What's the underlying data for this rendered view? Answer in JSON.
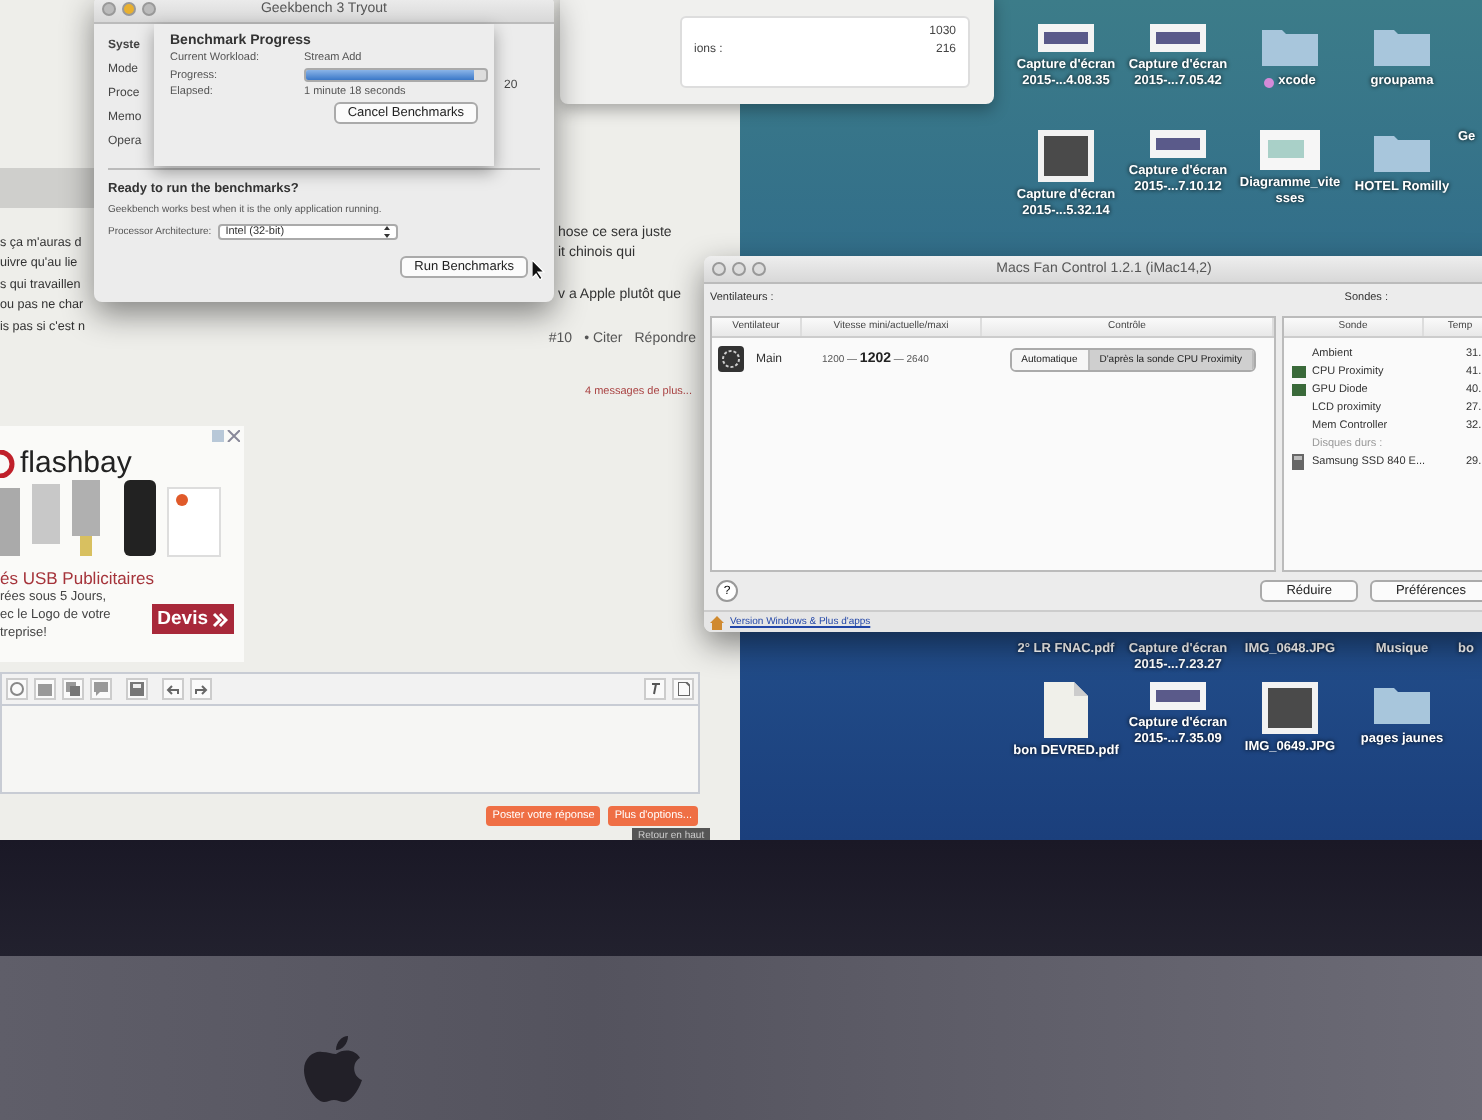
{
  "forum": {
    "left_fragments": [
      "s ça m'auras d",
      "uivre qu'au lie",
      "s qui travaillen",
      "ou pas ne char",
      "is pas si c'est n"
    ],
    "right_fragments": [
      "hose ce sera juste",
      "it chinois qui",
      "v a Apple plutôt que"
    ],
    "post_number": "#10",
    "cite_link": "• Citer",
    "reply_link": "Répondre",
    "more_messages": "4 messages de plus...",
    "ad": {
      "brand": "flashbay",
      "headline": "és USB Publicitaires",
      "body_lines": [
        "rées sous 5 Jours,",
        "ec le Logo de votre",
        "treprise!"
      ],
      "cta": "Devis"
    },
    "buttons": [
      "Poster votre réponse",
      "Plus d'options..."
    ],
    "tooltip": "Retour en haut"
  },
  "stats_panel": {
    "rows": [
      {
        "value": "1030"
      },
      {
        "label": "ions :",
        "value": "216"
      }
    ]
  },
  "geekbench": {
    "title": "Geekbench 3 Tryout",
    "hidden_labels": [
      "Syste",
      "Mode",
      "Proce",
      "Memo",
      "Opera"
    ],
    "side_value": "20",
    "sheet": {
      "title": "Benchmark Progress",
      "workload_label": "Current Workload:",
      "workload": "Stream Add",
      "progress_label": "Progress:",
      "progress": {
        "level": 0.93
      },
      "elapsed_label": "Elapsed:",
      "elapsed": "1 minute 18 seconds",
      "cancel_button": "Cancel Benchmarks"
    },
    "ready_title": "Ready to run the benchmarks?",
    "ready_text": "Geekbench works best when it is the only application running.",
    "arch_label": "Processor Architecture:",
    "arch_value": "Intel (32-bit)",
    "run_button": "Run Benchmarks"
  },
  "fan_control": {
    "title": "Macs Fan Control 1.2.1 (iMac14,2)",
    "fans_label": "Ventilateurs :",
    "sensors_label": "Sondes :",
    "fan_columns": [
      "Ventilateur",
      "Vitesse mini/actuelle/maxi",
      "Contrôle"
    ],
    "fans": [
      {
        "name": "Main",
        "speeds": "1200 — **1202** — 2640",
        "controls": [
          {
            "label": "Automatique",
            "selected": false
          },
          {
            "label": "D'après la sonde CPU Proximity",
            "selected": true
          }
        ]
      }
    ],
    "sensor_columns": [
      "Sonde",
      "Temp"
    ],
    "sensors": [
      {
        "kind": "plain",
        "name": "Ambient",
        "value": "31."
      },
      {
        "kind": "chip",
        "name": "CPU Proximity",
        "value": "41."
      },
      {
        "kind": "chip",
        "name": "GPU Diode",
        "value": "40."
      },
      {
        "kind": "plain",
        "name": "LCD proximity",
        "value": "27."
      },
      {
        "kind": "plain",
        "name": "Mem Controller",
        "value": "32."
      },
      {
        "kind": "group",
        "name": "Disques durs :"
      },
      {
        "kind": "drive",
        "name": "Samsung SSD 840 E...",
        "value": "29."
      }
    ],
    "buttons": [
      "Réduire",
      "Préférences"
    ],
    "help_button": "?",
    "footer_link": "Version Windows & Plus d'apps"
  },
  "desktop": {
    "rows": [
      [
        {
          "kind": "screenshot",
          "label": [
            "Capture d'écran",
            "2015-...4.08.35"
          ]
        },
        {
          "kind": "screenshot",
          "label": [
            "Capture d'écran",
            "2015-...7.05.42"
          ]
        },
        {
          "kind": "folder",
          "label": [
            "xcode"
          ],
          "color": "#d48ad8"
        },
        {
          "kind": "folder",
          "label": [
            "groupama"
          ]
        }
      ],
      [
        {
          "kind": "photo",
          "label": [
            "Capture d'écran",
            "2015-...5.32.14"
          ]
        },
        {
          "kind": "screenshot",
          "label": [
            "Capture d'écran",
            "2015-...7.10.12"
          ]
        },
        {
          "kind": "diagram",
          "label": [
            "Diagramme_vite",
            "sses"
          ]
        },
        {
          "kind": "folder",
          "label": [
            "HOTEL Romilly"
          ]
        },
        {
          "label": [
            "Ge"
          ]
        }
      ],
      [
        {
          "label": [
            "2° LR FNAC.pdf"
          ]
        },
        {
          "label": [
            "Capture d'écran",
            "2015-...7.23.27"
          ]
        },
        {
          "label": [
            "IMG_0648.JPG"
          ]
        },
        {
          "label": [
            "Musique"
          ]
        },
        {
          "label": [
            "bo"
          ]
        }
      ],
      [
        {
          "kind": "pdf",
          "label": [
            "bon DEVRED.pdf"
          ]
        },
        {
          "kind": "screenshot",
          "label": [
            "Capture d'écran",
            "2015-...7.35.09"
          ]
        },
        {
          "kind": "photo",
          "label": [
            "IMG_0649.JPG"
          ]
        },
        {
          "kind": "folder",
          "label": [
            "pages jaunes"
          ]
        }
      ]
    ]
  }
}
